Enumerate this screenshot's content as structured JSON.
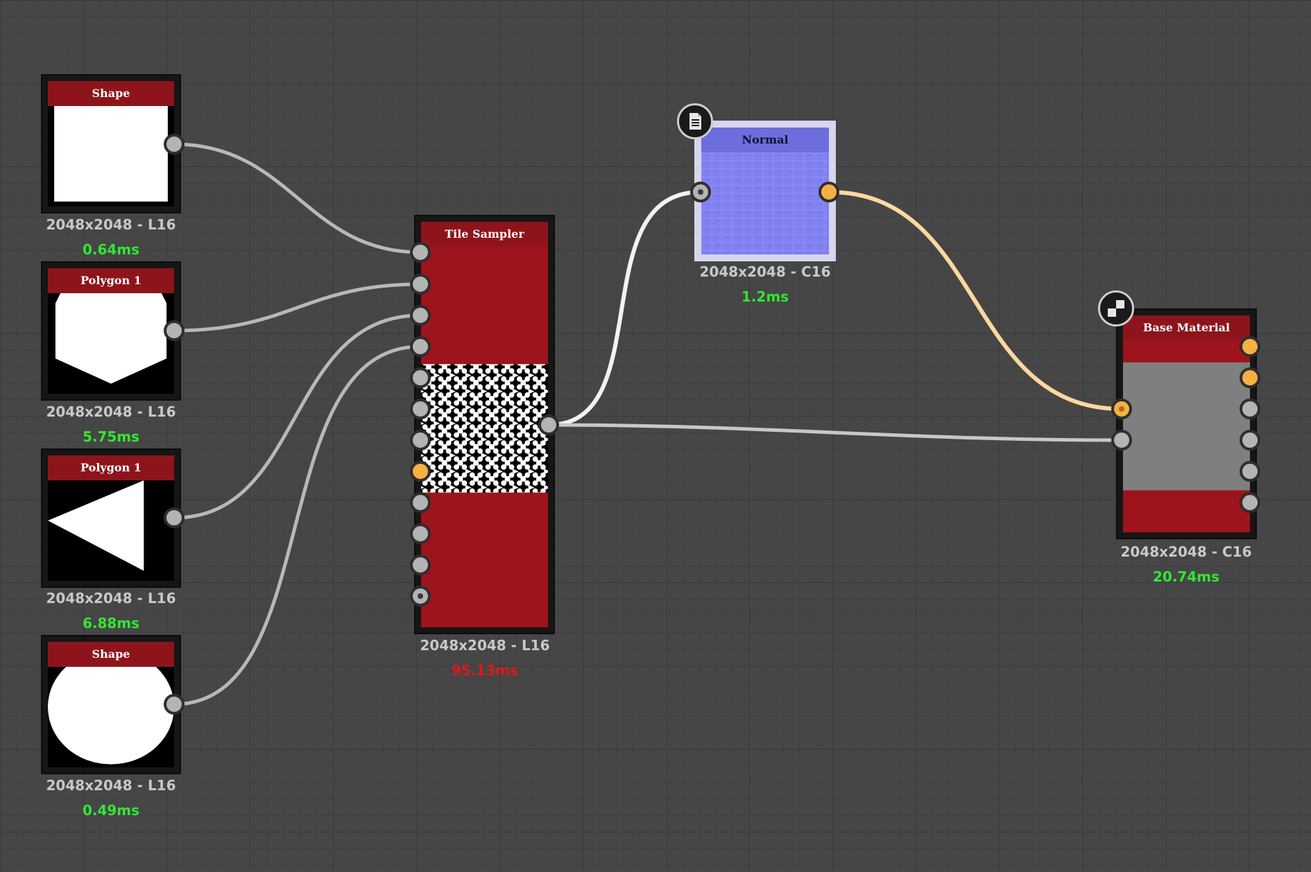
{
  "nodes": {
    "shape1": {
      "title": "Shape",
      "resolution": "2048x2048 - L16",
      "time": "0.64ms"
    },
    "polygon1": {
      "title": "Polygon 1",
      "resolution": "2048x2048 - L16",
      "time": "5.75ms"
    },
    "polygon2": {
      "title": "Polygon 1",
      "resolution": "2048x2048 - L16",
      "time": "6.88ms"
    },
    "shape2": {
      "title": "Shape",
      "resolution": "2048x2048 - L16",
      "time": "0.49ms"
    },
    "tile_sampler": {
      "title": "Tile Sampler",
      "resolution": "2048x2048 - L16",
      "time": "95.13ms"
    },
    "normal": {
      "title": "Normal",
      "resolution": "2048x2048 - C16",
      "time": "1.2ms",
      "icon": "document-icon"
    },
    "base_material": {
      "title": "Base Material",
      "resolution": "2048x2048 - C16",
      "time": "20.74ms",
      "icon": "checker-icon"
    }
  },
  "colors": {
    "header": "#8e141c",
    "node_body_red": "#9e141c",
    "wire_gray": "#b8b8b8",
    "wire_white": "#f2f2f2",
    "wire_orange": "#ffd8a0",
    "port_gray": "#b4b4b4",
    "port_orange": "#f7b042",
    "time_ok": "#33e633",
    "time_slow": "#e01818",
    "normal_border": "#cfcfe6",
    "normal_header": "#6d6ddd",
    "normal_body": "#8080f0"
  }
}
